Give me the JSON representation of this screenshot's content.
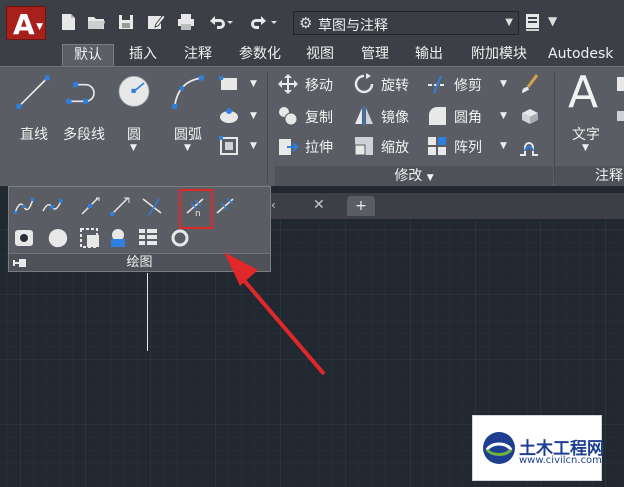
{
  "title_bar": {
    "workspace_label": "草图与注释"
  },
  "ribbon_tabs": [
    {
      "label": "默认",
      "active": true
    },
    {
      "label": "插入",
      "active": false
    },
    {
      "label": "注释",
      "active": false
    },
    {
      "label": "参数化",
      "active": false
    },
    {
      "label": "视图",
      "active": false
    },
    {
      "label": "管理",
      "active": false
    },
    {
      "label": "输出",
      "active": false
    },
    {
      "label": "附加模块",
      "active": false
    },
    {
      "label": "Autodesk",
      "active": false
    }
  ],
  "draw_group": {
    "line": "直线",
    "polyline": "多段线",
    "circle": "圆",
    "arc": "圆弧",
    "panel_title": "绘图"
  },
  "modify_group": {
    "move": "移动",
    "rotate": "旋转",
    "trim": "修剪",
    "copy": "复制",
    "mirror": "镜像",
    "fillet": "圆角",
    "stretch": "拉伸",
    "scale": "缩放",
    "array": "阵列",
    "panel_title": "修改"
  },
  "annotation_group": {
    "text": "文字",
    "panel_title": "注释"
  },
  "colors": {
    "app_red": "#a8201c",
    "highlight_red": "#e0282a",
    "ribbon_gray": "#5a5d63",
    "canvas_dark": "#212830",
    "watermark_blue": "#1e3f91"
  },
  "watermark": {
    "title": "土木工程网",
    "url": "www.civilcn.com"
  }
}
